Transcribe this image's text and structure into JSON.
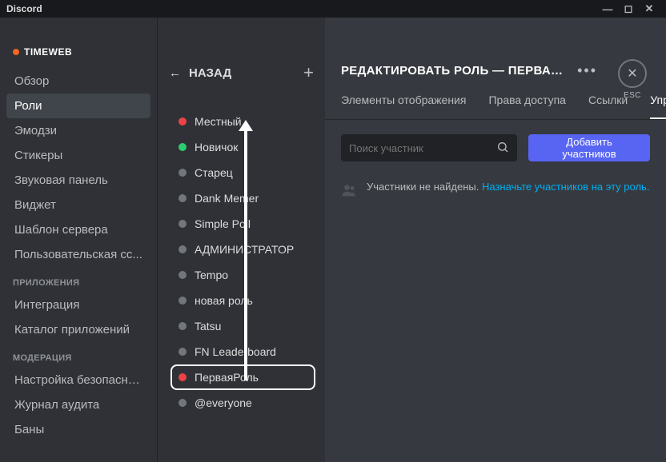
{
  "titlebar": {
    "app": "Discord"
  },
  "server": {
    "name": "TIMEWEB"
  },
  "sidebar": {
    "items": [
      {
        "label": "Обзор"
      },
      {
        "label": "Роли"
      },
      {
        "label": "Эмодзи"
      },
      {
        "label": "Стикеры"
      },
      {
        "label": "Звуковая панель"
      },
      {
        "label": "Виджет"
      },
      {
        "label": "Шаблон сервера"
      },
      {
        "label": "Пользовательская сс..."
      }
    ],
    "cat_apps": "ПРИЛОЖЕНИЯ",
    "apps": [
      {
        "label": "Интеграция"
      },
      {
        "label": "Каталог приложений"
      }
    ],
    "cat_mod": "МОДЕРАЦИЯ",
    "mod": [
      {
        "label": "Настройка безопасно..."
      },
      {
        "label": "Журнал аудита"
      },
      {
        "label": "Баны"
      }
    ]
  },
  "roles_panel": {
    "back": "НАЗАД",
    "list": [
      {
        "label": "Местный",
        "color": "#ed4245"
      },
      {
        "label": "Новичок",
        "color": "#2ecc71"
      },
      {
        "label": "Старец",
        "color": "#72767d"
      },
      {
        "label": "Dank Memer",
        "color": "#72767d"
      },
      {
        "label": "Simple Poll",
        "color": "#72767d"
      },
      {
        "label": "АДМИНИСТРАТОР",
        "color": "#72767d"
      },
      {
        "label": "Tempo",
        "color": "#72767d"
      },
      {
        "label": "новая роль",
        "color": "#72767d"
      },
      {
        "label": "Tatsu",
        "color": "#72767d"
      },
      {
        "label": "FN Leaderboard",
        "color": "#72767d"
      },
      {
        "label": "ПерваяРоль",
        "color": "#ed4245",
        "selected": true
      },
      {
        "label": "@everyone",
        "color": "#72767d"
      }
    ]
  },
  "editor": {
    "title": "РЕДАКТИРОВАТЬ РОЛЬ — ПЕРВАЯРО...",
    "esc": "ESC",
    "tabs": [
      {
        "label": "Элементы отображения"
      },
      {
        "label": "Права доступа"
      },
      {
        "label": "Ссылки"
      },
      {
        "label": "Упр",
        "active": true
      }
    ],
    "search_placeholder": "Поиск участник",
    "add_button": "Добавить участников",
    "empty_text": "Участники не найдены. ",
    "empty_link": "Назначьте участников на эту роль."
  }
}
